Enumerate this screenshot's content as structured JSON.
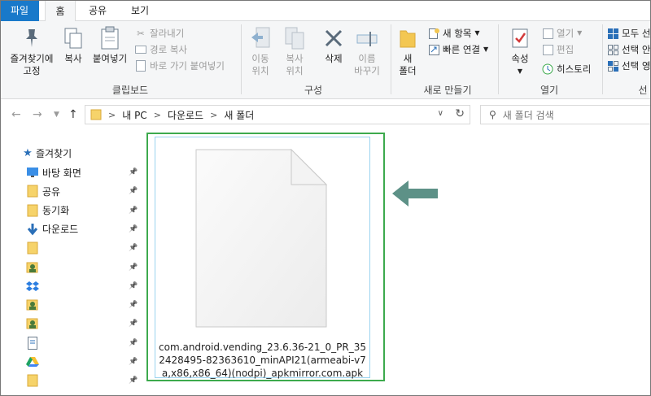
{
  "ribbon_tabs": [
    "파일",
    "홈",
    "공유",
    "보기"
  ],
  "clipboard": {
    "pin_label": "즐겨찾기에\n고정",
    "copy": "복사",
    "paste": "붙여넣기",
    "cut": "잘라내기",
    "copy_path": "경로 복사",
    "paste_shortcut": "바로 가기 붙여넣기",
    "group": "클립보드"
  },
  "organize": {
    "move_to": "이동\n위치",
    "copy_to": "복사\n위치",
    "delete": "삭제",
    "rename": "이름\n바꾸기",
    "group": "구성"
  },
  "new": {
    "new_folder": "새\n폴더",
    "new_item": "새 항목",
    "easy_access": "빠른 연결",
    "group": "새로 만들기"
  },
  "open": {
    "properties": "속성",
    "open": "열기",
    "edit": "편집",
    "history": "히스토리",
    "group": "열기"
  },
  "select": {
    "select_all": "모두 선",
    "select_none": "선택 안",
    "invert": "선택 영",
    "group": "선"
  },
  "address": {
    "breadcrumb": [
      "내 PC",
      "다운로드",
      "새 폴더"
    ],
    "search_placeholder": "새 폴더 검색"
  },
  "nav": {
    "root": "즐겨찾기",
    "items": [
      {
        "label": "바탕 화면",
        "icon": "desktop-icon"
      },
      {
        "label": "공유",
        "icon": "folder-icon"
      },
      {
        "label": "동기화",
        "icon": "folder-icon"
      },
      {
        "label": "다운로드",
        "icon": "download-icon"
      },
      {
        "label": "",
        "icon": "folder-icon"
      },
      {
        "label": "",
        "icon": "shared-folder-icon"
      },
      {
        "label": "",
        "icon": "dropbox-icon"
      },
      {
        "label": "",
        "icon": "shared-folder-icon"
      },
      {
        "label": "",
        "icon": "shared-folder-icon"
      },
      {
        "label": "",
        "icon": "document-icon"
      },
      {
        "label": "",
        "icon": "google-drive-icon"
      },
      {
        "label": "",
        "icon": "folder-icon"
      }
    ]
  },
  "file": {
    "name": "com.android.vending_23.6.36-21_0_PR_352428495-82363610_minAPI21(armeabi-v7a,x86,x86_64)(nodpi)_apkmirror.com.apk"
  },
  "colors": {
    "accent": "#1979ca",
    "highlight_box": "#3daa4d",
    "arrow": "#5d9187"
  }
}
